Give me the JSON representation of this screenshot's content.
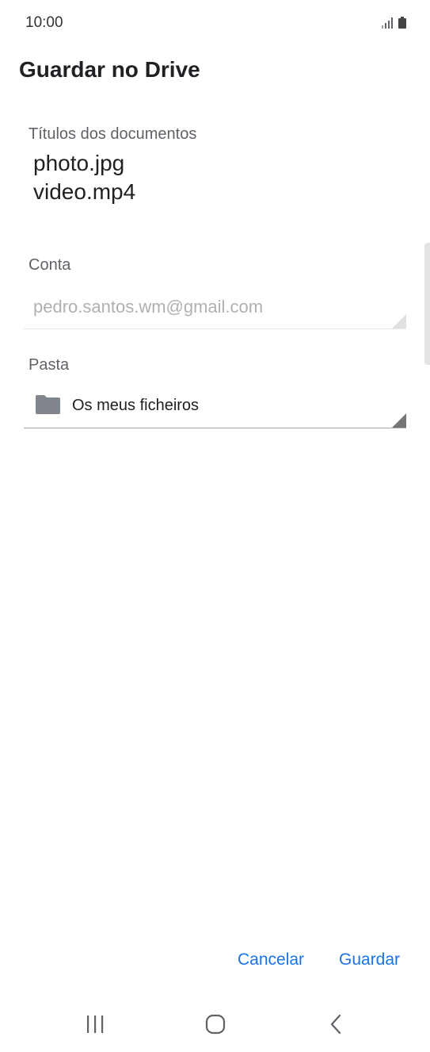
{
  "status_bar": {
    "time": "10:00",
    "icons": [
      "signal-icon",
      "battery-icon"
    ]
  },
  "dialog": {
    "title": "Guardar no Drive",
    "documents": {
      "label": "Títulos dos documentos",
      "items": [
        "photo.jpg",
        "video.mp4"
      ]
    },
    "account": {
      "label": "Conta",
      "value": "pedro.santos.wm@gmail.com"
    },
    "folder": {
      "label": "Pasta",
      "value": "Os meus ficheiros",
      "icon": "folder-icon"
    },
    "actions": {
      "cancel": "Cancelar",
      "save": "Guardar"
    }
  },
  "nav_bar": {
    "icons": [
      "recents-icon",
      "home-icon",
      "back-icon"
    ]
  },
  "colors": {
    "accent": "#1a73e8",
    "label": "#5f6368",
    "disabled_text": "#b0b0b0",
    "folder_icon": "#80868b"
  }
}
